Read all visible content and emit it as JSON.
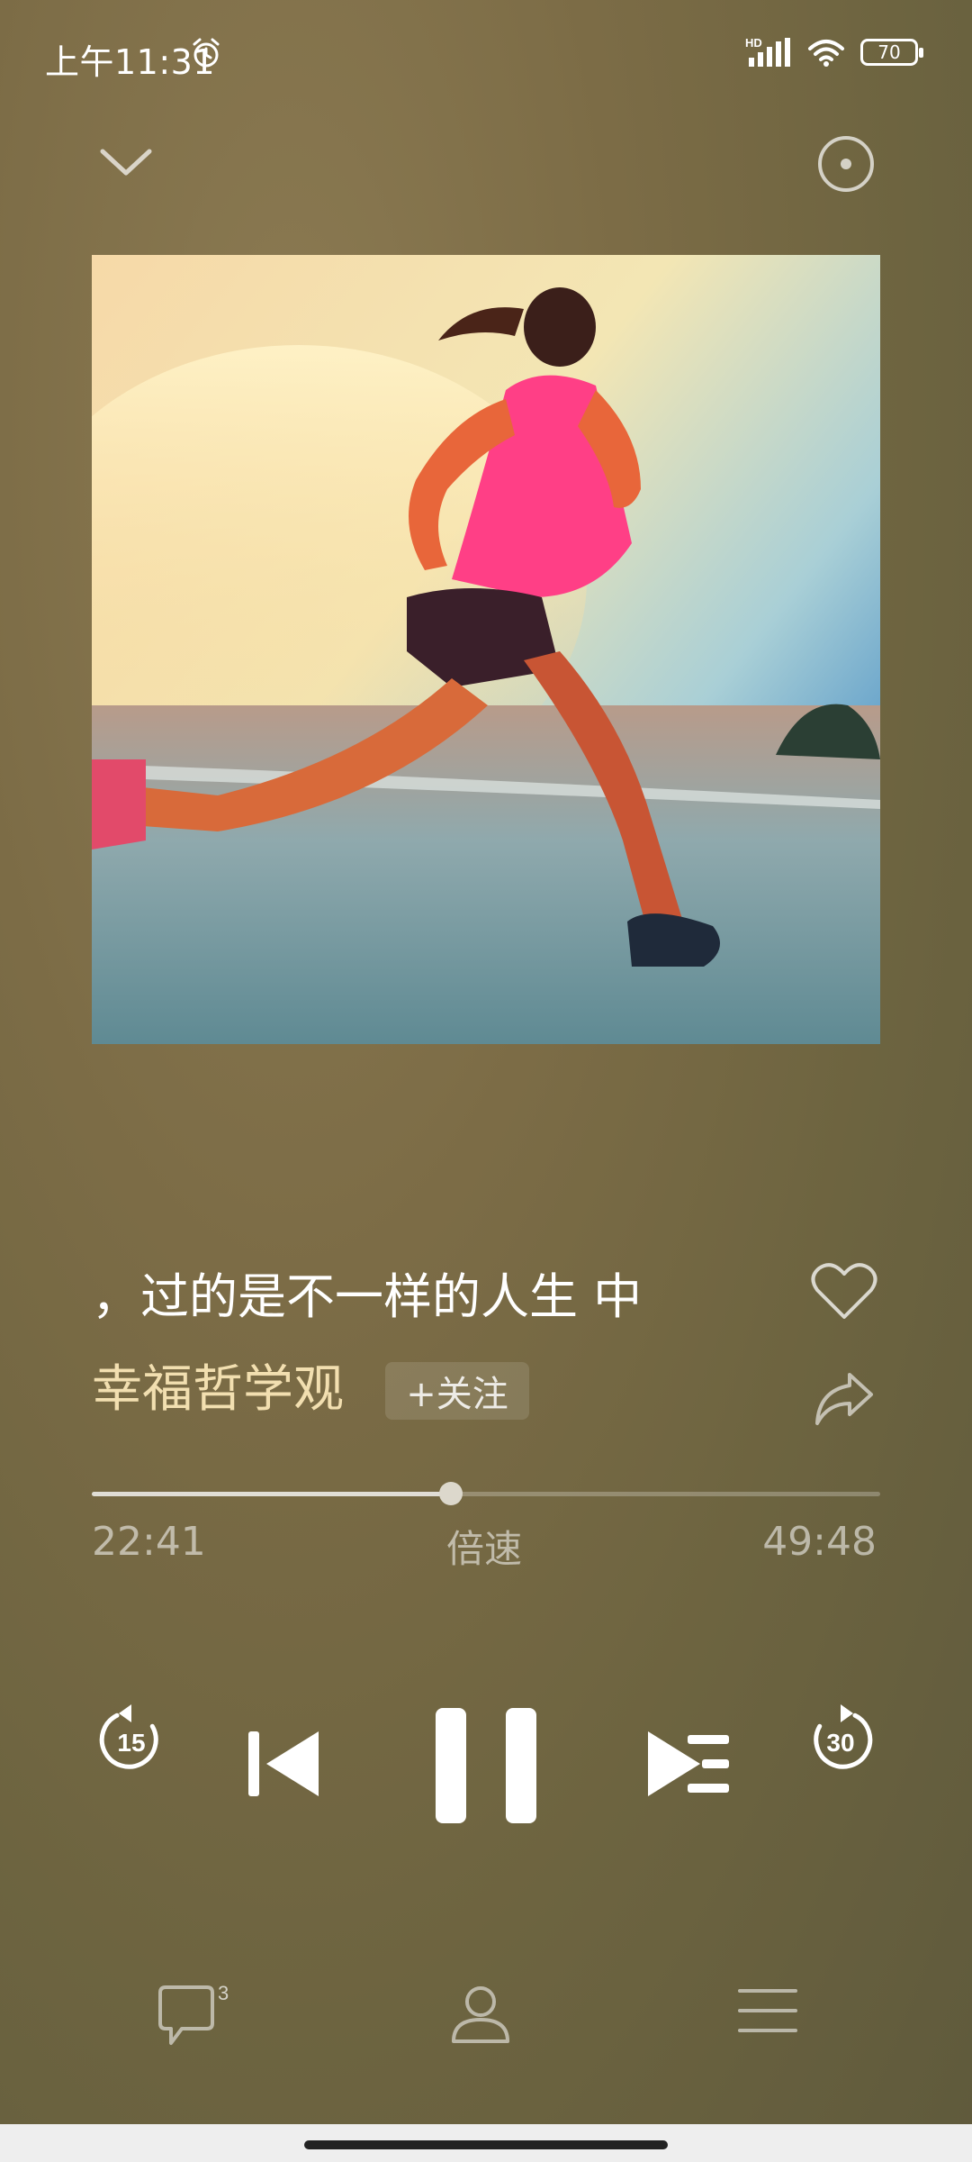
{
  "status": {
    "time": "上午11:31",
    "battery": "70",
    "network": "HD"
  },
  "track": {
    "title": "，过的是不一样的人生 中",
    "author": "幸福哲学观",
    "follow_label": "+关注",
    "progress": 0.455
  },
  "time": {
    "current": "22:41",
    "total": "49:48",
    "speed_label": "倍速"
  },
  "controls": {
    "rewind_seconds": "15",
    "forward_seconds": "30"
  },
  "nav": {
    "comments_count": "3"
  },
  "icons": [
    "alarm-icon",
    "signal-icon",
    "wifi-icon",
    "battery-icon",
    "chevron-down-icon",
    "disc-icon",
    "heart-icon",
    "share-icon",
    "rewind-15-icon",
    "previous-icon",
    "pause-icon",
    "next-playlist-icon",
    "forward-30-icon",
    "comments-icon",
    "profile-icon",
    "menu-icon"
  ]
}
